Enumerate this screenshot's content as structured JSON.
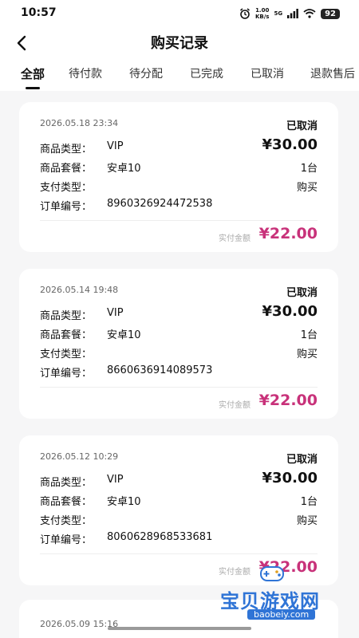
{
  "status_bar": {
    "time": "10:57",
    "net_speed_value": "1.00",
    "net_speed_unit": "KB/s",
    "signal": "5G",
    "battery": "92"
  },
  "nav": {
    "title": "购买记录",
    "back_icon": "chevron-left-icon"
  },
  "tabs": [
    {
      "label": "全部",
      "active": true
    },
    {
      "label": "待付款",
      "active": false
    },
    {
      "label": "待分配",
      "active": false
    },
    {
      "label": "已完成",
      "active": false
    },
    {
      "label": "已取消",
      "active": false
    },
    {
      "label": "退款售后",
      "active": false
    }
  ],
  "orders": [
    {
      "date": "2026.05.18 23:34",
      "status": "已取消",
      "type_label": "商品类型：",
      "type_value": "VIP",
      "price": "¥30.00",
      "package_label": "商品套餐：",
      "package_value": "安卓10",
      "quantity": "1台",
      "pay_label": "支付类型：",
      "pay_value": "购买",
      "order_label": "订单编号：",
      "order_no": "8960326924472538",
      "paid_label": "实付金额",
      "paid_amount": "¥22.00"
    },
    {
      "date": "2026.05.14 19:48",
      "status": "已取消",
      "type_label": "商品类型：",
      "type_value": "VIP",
      "price": "¥30.00",
      "package_label": "商品套餐：",
      "package_value": "安卓10",
      "quantity": "1台",
      "pay_label": "支付类型：",
      "pay_value": "购买",
      "order_label": "订单编号：",
      "order_no": "8660636914089573",
      "paid_label": "实付金额",
      "paid_amount": "¥22.00"
    },
    {
      "date": "2026.05.12 10:29",
      "status": "已取消",
      "type_label": "商品类型：",
      "type_value": "VIP",
      "price": "¥30.00",
      "package_label": "商品套餐：",
      "package_value": "安卓10",
      "quantity": "1台",
      "pay_label": "支付类型：",
      "pay_value": "购买",
      "order_label": "订单编号：",
      "order_no": "8060628968533681",
      "paid_label": "实付金额",
      "paid_amount": "¥22.00"
    }
  ],
  "partial_order": {
    "date": "2026.05.09 15:16"
  },
  "watermark": {
    "text": "宝贝游戏网",
    "url": "baobeiy.com"
  },
  "colors": {
    "accent_price": "#c8327a",
    "watermark_blue": "#2f74d6",
    "background": "#f6f6f7"
  }
}
